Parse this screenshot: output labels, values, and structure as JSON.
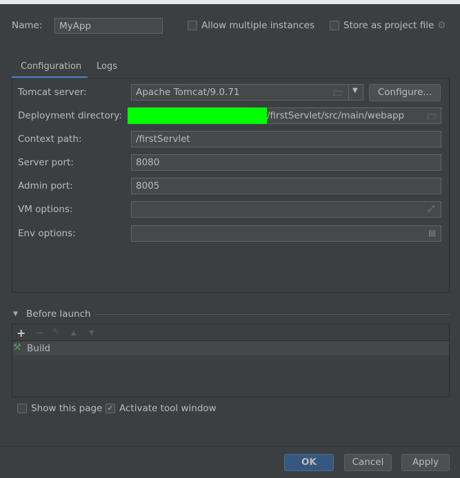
{
  "header": {
    "name_label": "Name:",
    "name_value": "MyApp",
    "allow_multiple": {
      "label": "Allow multiple instances",
      "checked": false
    },
    "store_project": {
      "label": "Store as project file",
      "checked": false
    }
  },
  "tabs": [
    {
      "label": "Configuration",
      "active": true
    },
    {
      "label": "Logs",
      "active": false
    }
  ],
  "config": {
    "tomcat_label": "Tomcat server:",
    "tomcat_value": "Apache Tomcat/9.0.71",
    "configure_label": "Configure...",
    "deploy_label": "Deployment directory:",
    "deploy_value": "/firstServlet/src/main/webapp",
    "redaction_color": "#00ff00",
    "context_label": "Context path:",
    "context_value": "/firstServlet",
    "server_port_label": "Server port:",
    "server_port_value": "8080",
    "admin_port_label": "Admin port:",
    "admin_port_value": "8005",
    "vm_label": "VM options:",
    "vm_value": "",
    "env_label": "Env options:",
    "env_value": ""
  },
  "before_launch": {
    "title": "Before launch",
    "items": [
      {
        "label": "Build",
        "icon": "hammer-icon"
      }
    ]
  },
  "options": {
    "show_page": {
      "label": "Show this page",
      "checked": false
    },
    "activate_tool": {
      "label": "Activate tool window",
      "checked": true
    }
  },
  "footer": {
    "ok": "OK",
    "cancel": "Cancel",
    "apply": "Apply"
  }
}
